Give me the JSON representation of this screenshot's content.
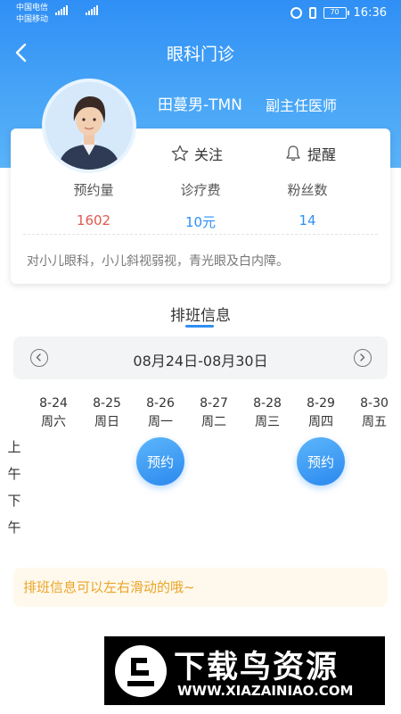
{
  "status_bar": {
    "carrier1": "中国电信",
    "carrier2": "中国移动",
    "battery": "70",
    "time": "16:36"
  },
  "nav": {
    "title": "眼科门诊"
  },
  "doctor": {
    "name": "田蔓男-TMN",
    "title": "副主任医师"
  },
  "actions": {
    "follow": "关注",
    "remind": "提醒"
  },
  "stats": [
    {
      "label": "预约量",
      "value": "1602",
      "color": "#e0594f"
    },
    {
      "label": "诊疗费",
      "value": "10元",
      "color": "#2f8ff5"
    },
    {
      "label": "粉丝数",
      "value": "14",
      "color": "#2f8ff5"
    }
  ],
  "intro": "对小儿眼科，小儿斜视弱视，青光眼及白内障。",
  "schedule": {
    "title": "排班信息",
    "week_range": "08月24日-08月30日",
    "days": [
      {
        "date": "8-24",
        "weekday": "周六"
      },
      {
        "date": "8-25",
        "weekday": "周日"
      },
      {
        "date": "8-26",
        "weekday": "周一"
      },
      {
        "date": "8-27",
        "weekday": "周二"
      },
      {
        "date": "8-28",
        "weekday": "周三"
      },
      {
        "date": "8-29",
        "weekday": "周四"
      },
      {
        "date": "8-30",
        "weekday": "周五"
      }
    ],
    "morning": "上\n午",
    "afternoon": "下\n午",
    "book_label_1": "预约",
    "book_label_2": "预约",
    "tip": "排班信息可以左右滑动的哦~"
  },
  "watermark": {
    "text": "下载鸟资源",
    "url": "WWW.XIAZAINIAO.COM"
  },
  "colors": {
    "primary": "#2f8ff5",
    "appointments": "#e0594f",
    "tip_text": "#eba428"
  }
}
